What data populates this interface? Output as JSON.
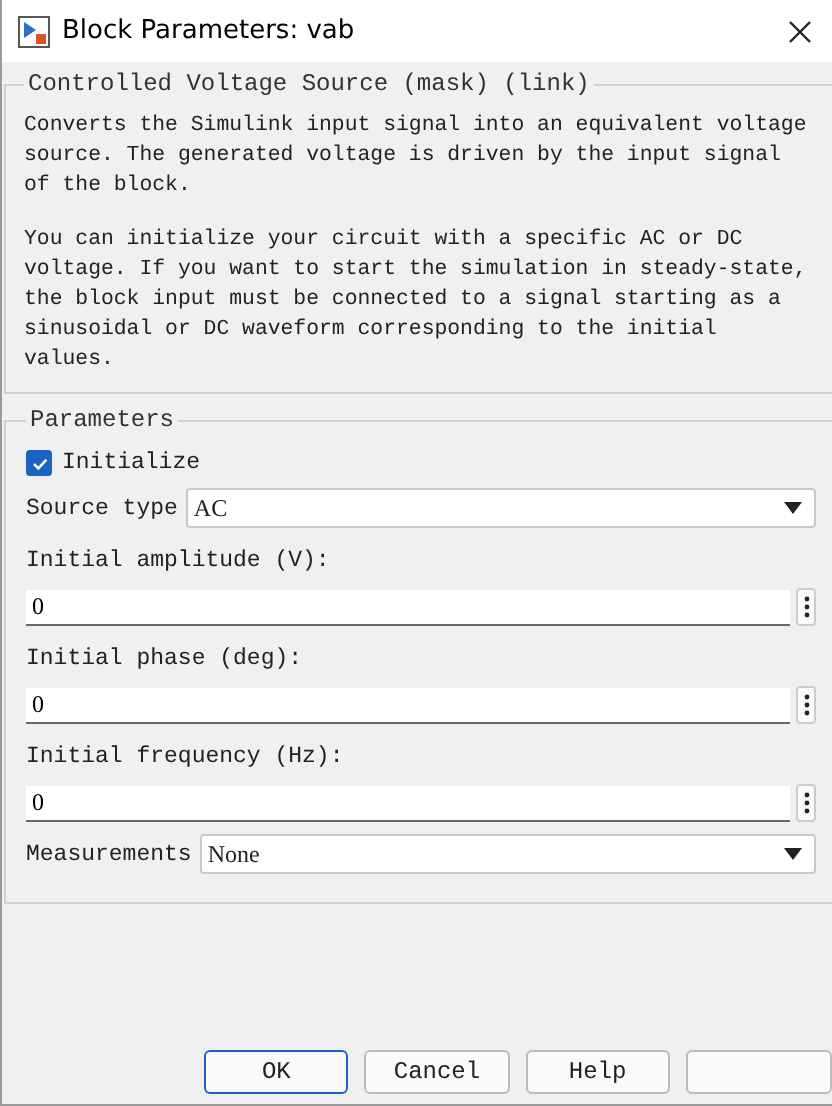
{
  "window": {
    "title": "Block Parameters: vab"
  },
  "description": {
    "title": "Controlled Voltage Source (mask) (link)",
    "paragraphs": [
      "Converts the Simulink input signal into an equivalent voltage source. The generated voltage is driven by the input signal of the block.",
      "You can initialize your circuit with a specific AC or DC voltage. If you want to start the simulation in steady-state, the block input must be connected to a signal starting as a sinusoidal or DC waveform corresponding to the initial values."
    ]
  },
  "parameters": {
    "title": "Parameters",
    "items": [
      {
        "kind": "checkbox",
        "label": "Initialize",
        "checked": true
      },
      {
        "kind": "select",
        "label": "Source type",
        "value": "AC"
      },
      {
        "kind": "field",
        "label": "Initial amplitude (V):",
        "value": "0"
      },
      {
        "kind": "field",
        "label": "Initial phase (deg):",
        "value": "0"
      },
      {
        "kind": "field",
        "label": "Initial frequency (Hz):",
        "value": "0"
      },
      {
        "kind": "select",
        "label": "Measurements",
        "value": "None"
      }
    ]
  },
  "buttons": [
    {
      "label": "OK",
      "default": true
    },
    {
      "label": "Cancel",
      "default": false
    },
    {
      "label": "Help",
      "default": false
    }
  ]
}
